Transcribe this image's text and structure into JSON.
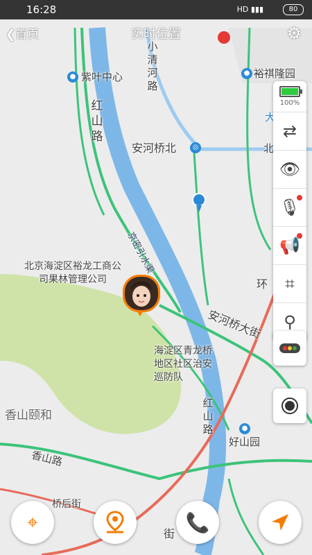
{
  "status_bar": {
    "time": "16:28",
    "signal": "HD ▮▮▮",
    "battery": "80"
  },
  "header": {
    "back_label": "首页",
    "title": "实时位置"
  },
  "map_labels": {
    "zizhong": "紫叶中心",
    "hongshan_road_top": "红山路",
    "xiaoqing_river": "小清河路",
    "yuqi": "裕祺隆园",
    "taiyu": "大秀花园",
    "anheqiao_north": "安河桥北",
    "bei": "北",
    "jingmi": "京密引水渠",
    "forest_admin": "北京海淀区裕龙工商公司果林管理公司",
    "anheqiao_street": "安河桥大街",
    "police": "海淀区青龙桥地区社区治安巡防队",
    "hongshan_road_bottom": "红山路",
    "xiangshan_yihe": "香山颐和",
    "haoshan": "好山园",
    "xiangshan_road": "香山路",
    "qiaohou": "桥后街",
    "huan": "环",
    "jie": "街"
  },
  "device_panel": {
    "battery_percent": 100,
    "battery_label": "100%"
  },
  "colors": {
    "accent": "#f57c00",
    "water": "#7db7e8",
    "road": "#3cc37a",
    "park": "#cfe3a8",
    "badge": "#e53935"
  },
  "icons": [
    "back-chevron-icon",
    "gear-icon",
    "swap-icon",
    "eye-icon",
    "microphone-icon",
    "megaphone-icon",
    "fence-icon",
    "location-pin-icon",
    "traffic-light-icon",
    "record-icon",
    "target-icon",
    "map-pin-icon",
    "phone-icon",
    "navigate-icon"
  ]
}
